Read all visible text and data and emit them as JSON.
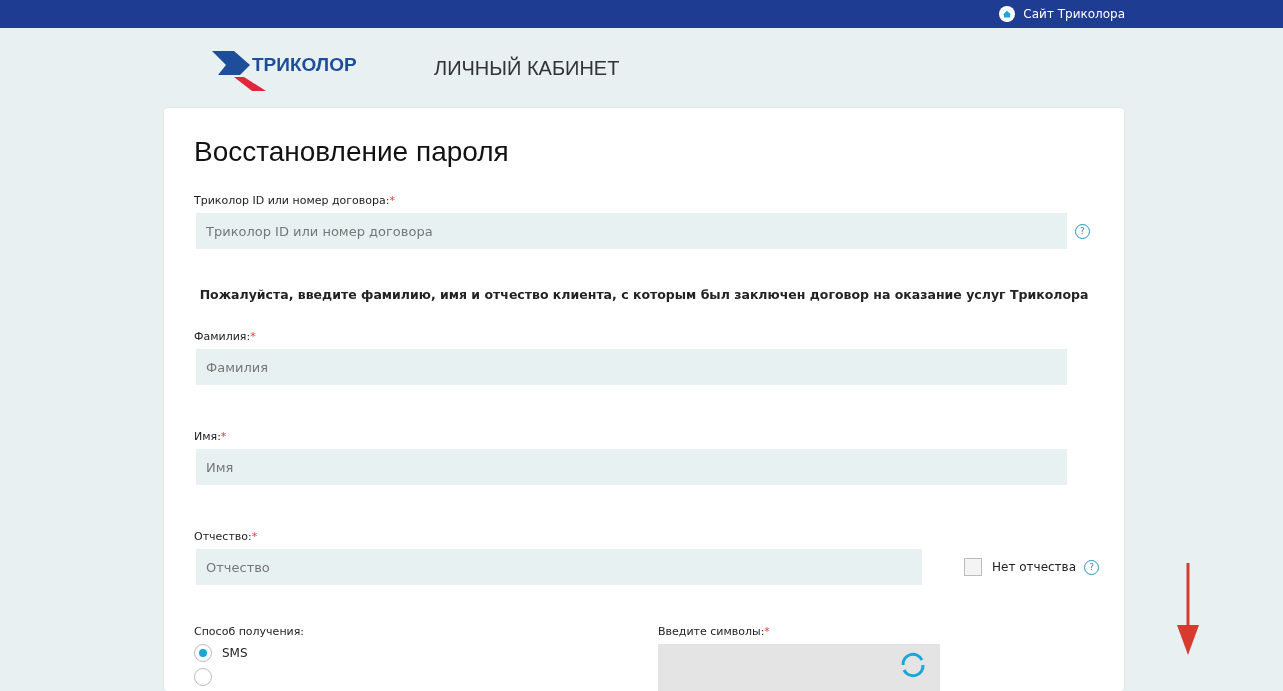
{
  "top_bar": {
    "site_link": "Сайт Триколора"
  },
  "header": {
    "logo_text": "ТРИКОЛОР",
    "section_title": "ЛИЧНЫЙ КАБИНЕТ"
  },
  "form": {
    "title": "Восстановление пароля",
    "id_field": {
      "label": "Триколор ID или номер договора:",
      "required_mark": "*",
      "placeholder": "Триколор ID или номер договора",
      "help": "?"
    },
    "notice": "Пожалуйста, введите фамилию, имя и отчество клиента, с которым был заключен договор на оказание услуг Триколора",
    "fields": [
      {
        "label": "Фамилия:",
        "required_mark": "*",
        "placeholder": "Фамилия"
      },
      {
        "label": "Имя:",
        "required_mark": "*",
        "placeholder": "Имя"
      },
      {
        "label": "Отчество:",
        "required_mark": "*",
        "placeholder": "Отчество",
        "option": {
          "label": "Нет отчества",
          "checked": false,
          "help": "?"
        }
      }
    ],
    "delivery": {
      "label": "Способ получения:",
      "options": [
        {
          "label": "SMS",
          "selected": true
        },
        {
          "selected": false
        }
      ]
    },
    "captcha": {
      "label": "Введите символы:",
      "required_mark": "*"
    }
  }
}
